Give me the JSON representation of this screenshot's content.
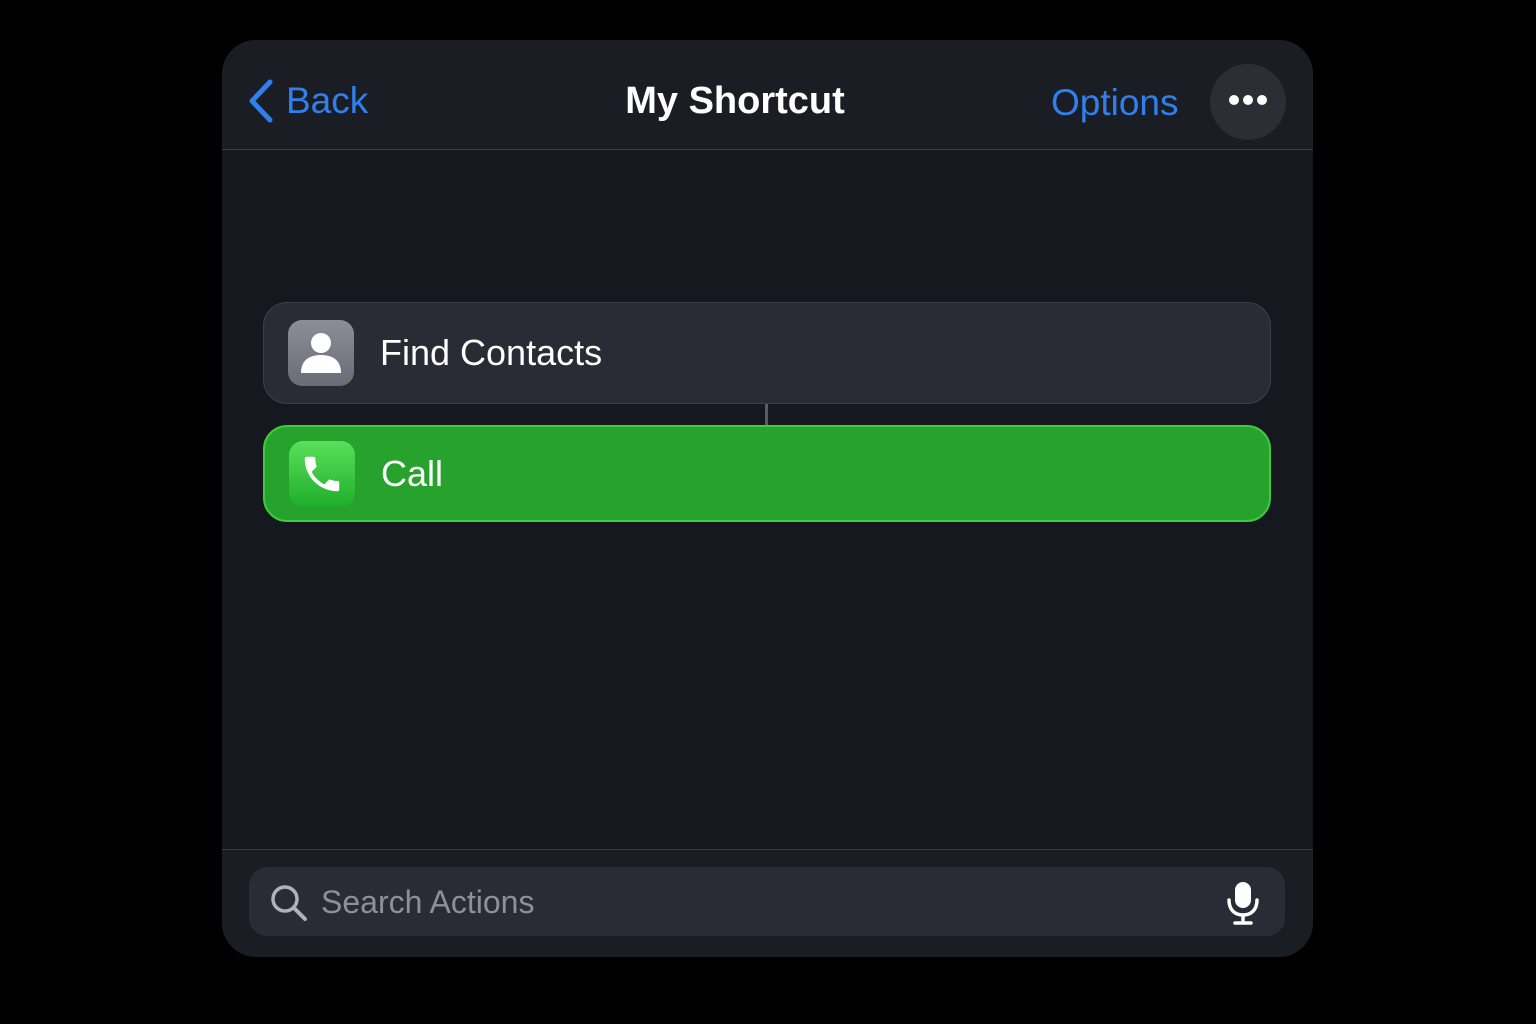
{
  "header": {
    "back_label": "Back",
    "title": "My Shortcut",
    "options_label": "Options",
    "more_icon": "ellipsis-icon"
  },
  "actions": [
    {
      "label": "Find Contacts",
      "icon": "contact-icon"
    },
    {
      "label": "Call",
      "icon": "phone-icon"
    }
  ],
  "search": {
    "placeholder": "Search Actions",
    "icon": "search-icon",
    "mic_icon": "microphone-icon"
  },
  "colors": {
    "accent": "#2f80ed",
    "call_green": "#27a22c",
    "background": "#16181f"
  }
}
